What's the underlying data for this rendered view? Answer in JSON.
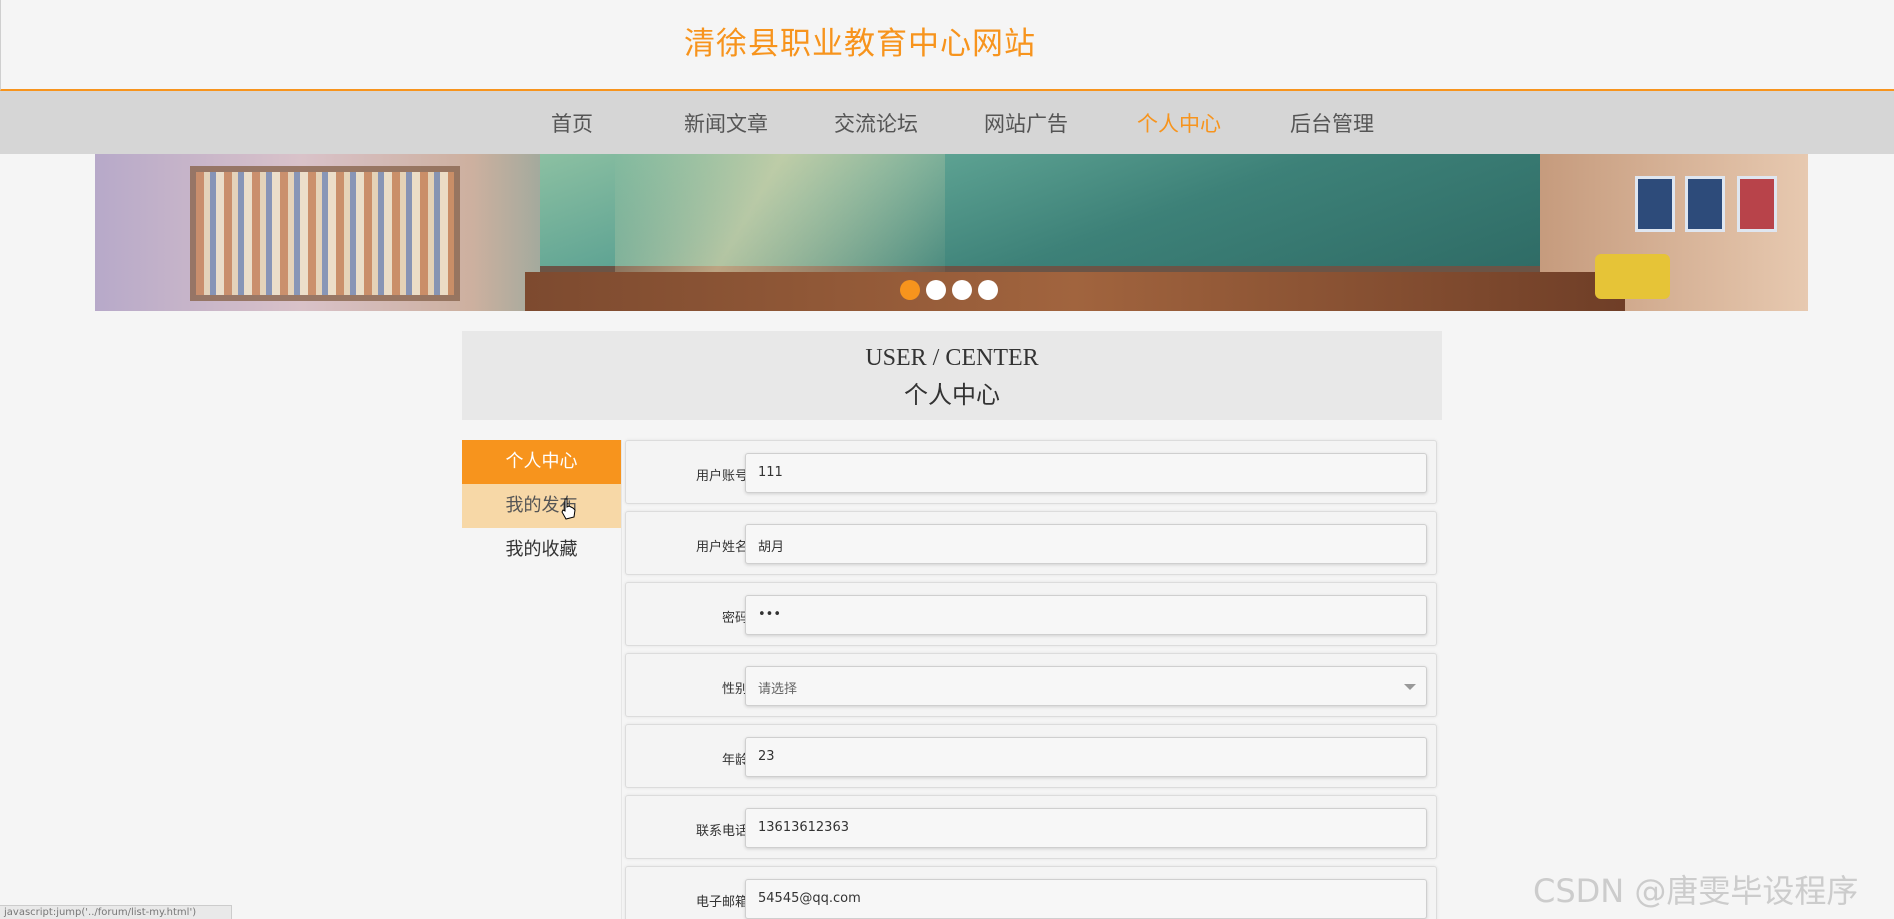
{
  "header": {
    "site_title": "清徐县职业教育中心网站"
  },
  "nav": {
    "items": [
      {
        "label": "首页",
        "active": false
      },
      {
        "label": "新闻文章",
        "active": false
      },
      {
        "label": "交流论坛",
        "active": false
      },
      {
        "label": "网站广告",
        "active": false
      },
      {
        "label": "个人中心",
        "active": true
      },
      {
        "label": "后台管理",
        "active": false
      }
    ]
  },
  "banner": {
    "slide_count": 4,
    "active_slide": 1
  },
  "center_header": {
    "en": "USER / CENTER",
    "cn": "个人中心"
  },
  "sidebar": {
    "items": [
      {
        "label": "个人中心",
        "state": "active"
      },
      {
        "label": "我的发布",
        "state": "hover"
      },
      {
        "label": "我的收藏",
        "state": "normal"
      }
    ]
  },
  "form": {
    "fields": [
      {
        "label": "用户账号",
        "value": "111"
      },
      {
        "label": "用户姓名",
        "value": "胡月"
      },
      {
        "label": "密码",
        "value": "•••"
      },
      {
        "label": "性别",
        "value": "请选择"
      },
      {
        "label": "年龄",
        "value": "23"
      },
      {
        "label": "联系电话",
        "value": "13613612363"
      },
      {
        "label": "电子邮箱",
        "value": "54545@qq.com"
      }
    ]
  },
  "status_bar": {
    "url": "javascript:jump('../forum/list-my.html')"
  },
  "watermark": "CSDN @唐雯毕设程序",
  "colors": {
    "accent": "#f7941d",
    "nav_bg": "#d6d6d6",
    "hover_bg": "#f7d8a7"
  }
}
